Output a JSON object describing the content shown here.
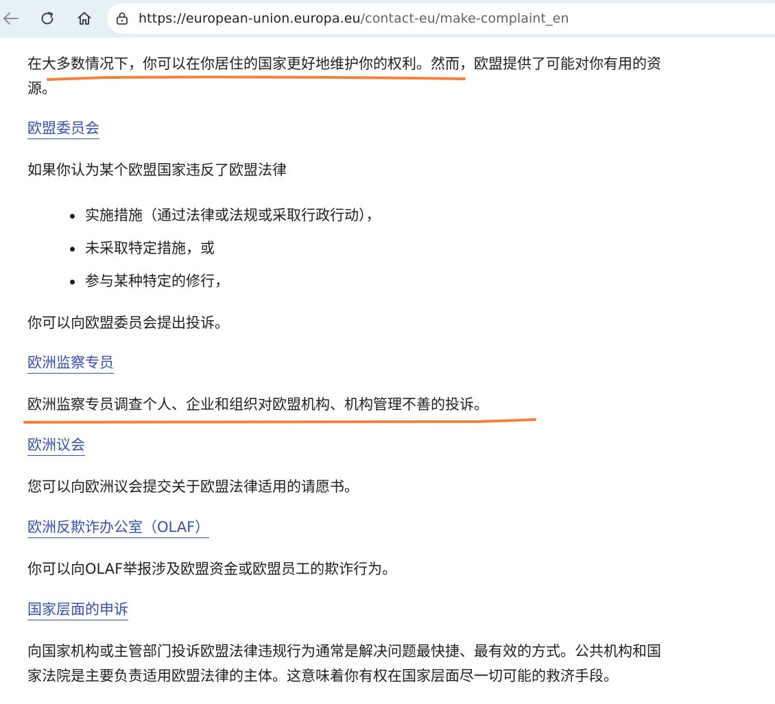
{
  "browser": {
    "url_domain": "https://european-union.europa.eu",
    "url_path": "/contact-eu/make-complaint_en"
  },
  "intro": {
    "line1": "在大多数情况下，你可以在你居住的国家更好地维护你的权利。然而，欧盟提供了可能对你有用的资",
    "line2": "源。"
  },
  "commission": {
    "link": "欧盟委员会",
    "lead": "如果你认为某个欧盟国家违反了欧盟法律",
    "bullets": [
      "实施措施（通过法律或法规或采取行政行动），",
      "未采取特定措施，或",
      "参与某种特定的修行，"
    ],
    "outro": "你可以向欧盟委员会提出投诉。"
  },
  "ombudsman": {
    "link": "欧洲监察专员",
    "text": "欧洲监察专员调查个人、企业和组织对欧盟机构、机构管理不善的投诉。"
  },
  "parliament": {
    "link": "欧洲议会",
    "text": "您可以向欧洲议会提交关于欧盟法律适用的请愿书。"
  },
  "olaf": {
    "link": "欧洲反欺诈办公室（OLAF）",
    "text": "你可以向OLAF举报涉及欧盟资金或欧盟员工的欺诈行为。"
  },
  "national": {
    "link": "国家层面的申诉",
    "line1": "向国家机构或主管部门投诉欧盟法律违规行为通常是解决问题最快捷、最有效的方式。公共机构和国",
    "line2": "家法院是主要负责适用欧盟法律的主体。这意味着你有权在国家层面尽一切可能的救济手段。"
  },
  "colors": {
    "toolbar_bg": "#e6f1f5",
    "link": "#3550b4",
    "highlight_marker": "#f5813d",
    "text": "#1f1f1f"
  },
  "icons": [
    "back-arrow-icon",
    "reload-icon",
    "home-icon",
    "lock-icon"
  ]
}
